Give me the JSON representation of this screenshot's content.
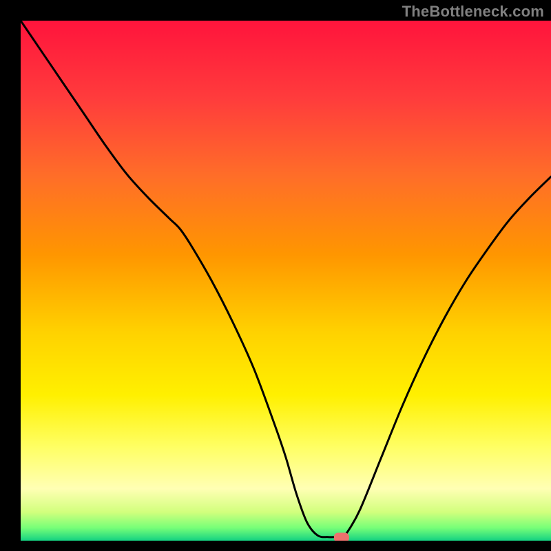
{
  "watermark": "TheBottleneck.com",
  "colors": {
    "background": "#000000",
    "stroke": "#000000",
    "marker": "#ed716d",
    "watermark": "#808080"
  },
  "chart_data": {
    "type": "line",
    "title": "",
    "xlabel": "",
    "ylabel": "",
    "xlim": [
      0,
      100
    ],
    "ylim": [
      0,
      100
    ],
    "gradient_stops": [
      {
        "offset": 0.0,
        "color": "#ff143c"
      },
      {
        "offset": 0.15,
        "color": "#ff3c3c"
      },
      {
        "offset": 0.3,
        "color": "#ff6e28"
      },
      {
        "offset": 0.45,
        "color": "#ff9600"
      },
      {
        "offset": 0.6,
        "color": "#ffd200"
      },
      {
        "offset": 0.72,
        "color": "#fff000"
      },
      {
        "offset": 0.82,
        "color": "#ffff64"
      },
      {
        "offset": 0.9,
        "color": "#ffffb4"
      },
      {
        "offset": 0.945,
        "color": "#d2ff7d"
      },
      {
        "offset": 0.975,
        "color": "#78ff78"
      },
      {
        "offset": 1.0,
        "color": "#14d282"
      }
    ],
    "series": [
      {
        "name": "bottleneck-curve",
        "x": [
          0.0,
          4,
          8,
          12,
          16,
          20,
          24,
          28,
          30,
          32,
          36,
          40,
          44,
          48,
          50,
          52,
          54,
          56,
          58,
          59.5,
          60.5,
          61.5,
          64,
          68,
          72,
          76,
          80,
          84,
          88,
          92,
          96,
          100
        ],
        "y": [
          100,
          94,
          88,
          82,
          76,
          70.5,
          66,
          62,
          60,
          57,
          50,
          42,
          33,
          22,
          16,
          9,
          3.5,
          1.0,
          0.7,
          0.7,
          0.7,
          1.5,
          6,
          16,
          26,
          35,
          43,
          50,
          56,
          61.5,
          66,
          70
        ]
      }
    ],
    "marker": {
      "x": 60.5,
      "y": 0.6
    },
    "annotations": []
  }
}
